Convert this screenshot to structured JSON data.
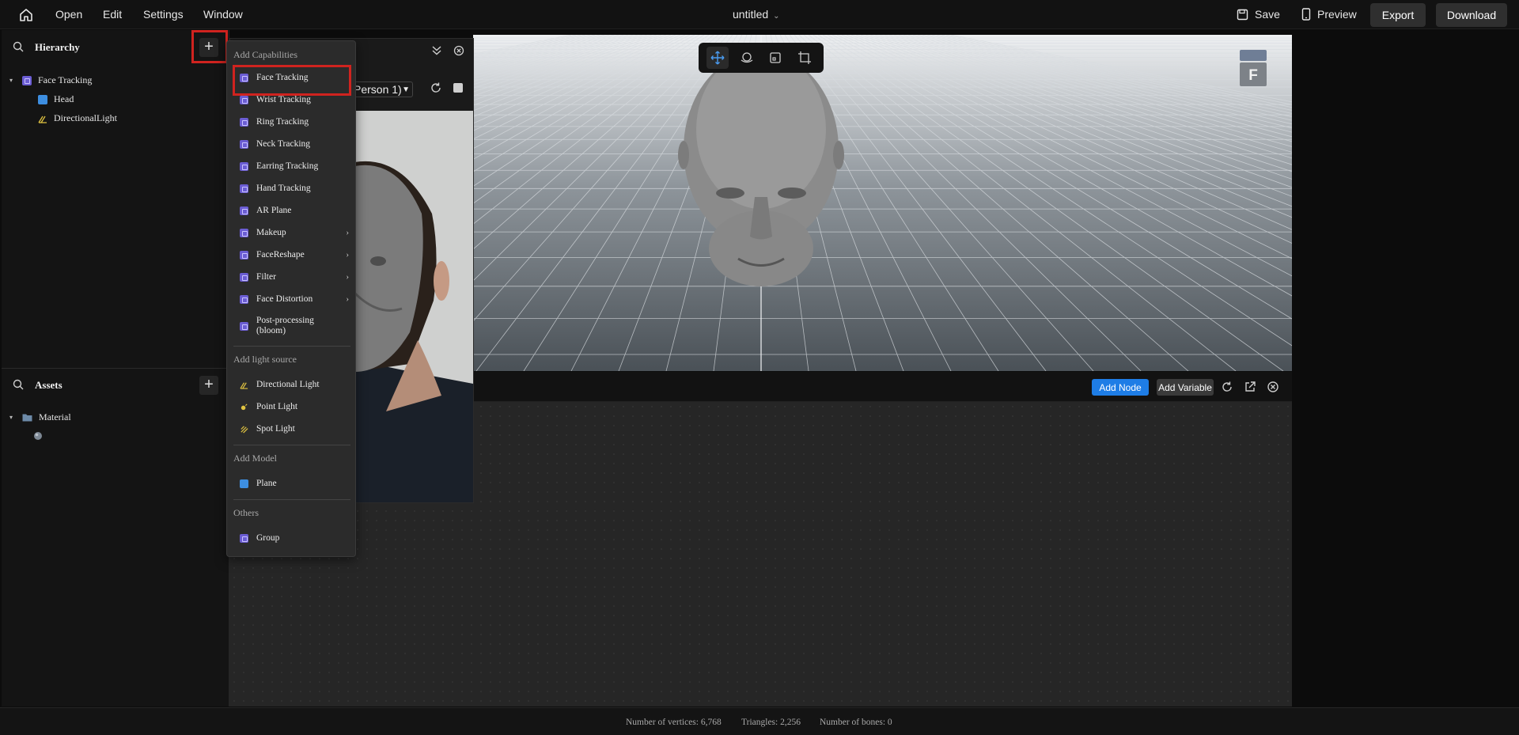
{
  "topbar": {
    "menu": [
      "Open",
      "Edit",
      "Settings",
      "Window"
    ],
    "project_title": "untitled",
    "save_label": "Save",
    "preview_label": "Preview",
    "export_label": "Export",
    "download_label": "Download"
  },
  "hierarchy": {
    "title": "Hierarchy",
    "items": [
      {
        "label": "Face Tracking",
        "icon": "capability-icon"
      },
      {
        "label": "Head",
        "icon": "model-icon"
      },
      {
        "label": "DirectionalLight",
        "icon": "directional-light-icon"
      }
    ]
  },
  "assets": {
    "title": "Assets",
    "items": [
      {
        "label": "Material",
        "icon": "folder-icon"
      }
    ]
  },
  "preview": {
    "person_select": "Person 1)"
  },
  "dropdown": {
    "section_capabilities": "Add Capabilities",
    "capabilities": [
      {
        "label": "Face Tracking",
        "submenu": false
      },
      {
        "label": "Wrist Tracking",
        "submenu": false
      },
      {
        "label": "Ring Tracking",
        "submenu": false
      },
      {
        "label": "Neck Tracking",
        "submenu": false
      },
      {
        "label": "Earring Tracking",
        "submenu": false
      },
      {
        "label": "Hand Tracking",
        "submenu": false
      },
      {
        "label": "AR Plane",
        "submenu": false
      },
      {
        "label": "Makeup",
        "submenu": true
      },
      {
        "label": "FaceReshape",
        "submenu": true
      },
      {
        "label": "Filter",
        "submenu": true
      },
      {
        "label": "Face Distortion",
        "submenu": true
      },
      {
        "label": "Post-processing (bloom)",
        "submenu": false
      }
    ],
    "section_light": "Add light source",
    "lights": [
      "Directional Light",
      "Point Light",
      "Spot Light"
    ],
    "section_model": "Add Model",
    "models": [
      "Plane"
    ],
    "section_others": "Others",
    "others": [
      "Group"
    ]
  },
  "nodegraph": {
    "add_node_label": "Add Node",
    "add_variable_label": "Add Variable"
  },
  "gizmo": {
    "label": "F"
  },
  "status": {
    "vertices": "Number of vertices: 6,768",
    "triangles": "Triangles: 2,256",
    "bones": "Number of bones: 0"
  },
  "colors": {
    "accent_blue": "#1e7de6",
    "capability_purple": "#6b5dd3",
    "light_yellow": "#e0c341",
    "highlight_red": "#d0231f"
  }
}
